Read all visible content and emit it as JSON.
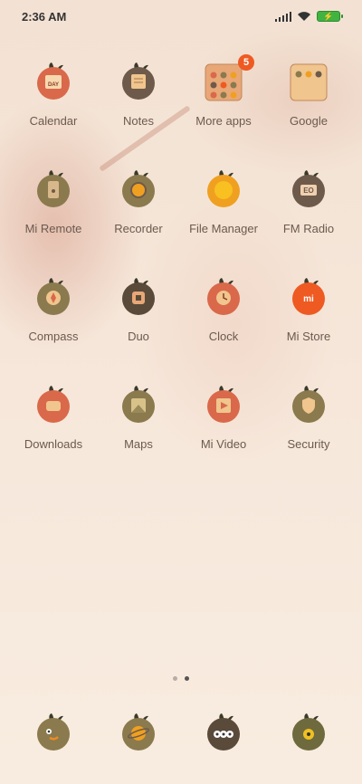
{
  "status_bar": {
    "time": "2:36 AM"
  },
  "apps": [
    {
      "label": "Calendar",
      "icon": "calendar-icon",
      "color": "#d9694a"
    },
    {
      "label": "Notes",
      "icon": "notes-icon",
      "color": "#6e5a4a"
    },
    {
      "label": "More apps",
      "icon": "folder-icon",
      "badge": "5",
      "color": "#e8a777"
    },
    {
      "label": "Google",
      "icon": "google-icon",
      "color": "#f0c58e"
    },
    {
      "label": "Mi Remote",
      "icon": "mi-remote-icon",
      "color": "#8a7a4e"
    },
    {
      "label": "Recorder",
      "icon": "recorder-icon",
      "color": "#8a7a4e"
    },
    {
      "label": "File Manager",
      "icon": "file-manager-icon",
      "color": "#f0a020"
    },
    {
      "label": "FM Radio",
      "icon": "fm-radio-icon",
      "color": "#6e5a4a"
    },
    {
      "label": "Compass",
      "icon": "compass-icon",
      "color": "#8a7a4e"
    },
    {
      "label": "Duo",
      "icon": "duo-icon",
      "color": "#5a4a3a"
    },
    {
      "label": "Clock",
      "icon": "clock-icon",
      "color": "#d9694a"
    },
    {
      "label": "Mi Store",
      "icon": "mi-store-icon",
      "color": "#ee5a22"
    },
    {
      "label": "Downloads",
      "icon": "downloads-icon",
      "color": "#d9694a"
    },
    {
      "label": "Maps",
      "icon": "maps-icon",
      "color": "#8a7a4e"
    },
    {
      "label": "Mi Video",
      "icon": "mi-video-icon",
      "color": "#d9694a"
    },
    {
      "label": "Security",
      "icon": "security-icon",
      "color": "#8a7a4e"
    }
  ],
  "dock": [
    {
      "icon": "phone-icon",
      "color": "#8a7a4e"
    },
    {
      "icon": "browser-icon",
      "color": "#8a7a4e"
    },
    {
      "icon": "messaging-icon",
      "color": "#5a4a3a"
    },
    {
      "icon": "camera-icon",
      "color": "#6e6a3e"
    }
  ],
  "pages": {
    "count": 2,
    "current": 2
  }
}
